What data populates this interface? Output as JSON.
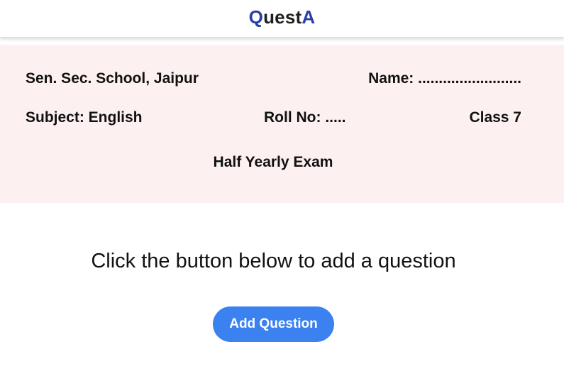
{
  "app": {
    "logo_part1_accent": "Q",
    "logo_part2": "uest",
    "logo_part3_accent": "A",
    "accent_color": "#2a3fa8"
  },
  "exam_header": {
    "school": "Sen. Sec. School, Jaipur",
    "name_label": "Name: .........................",
    "subject": "Subject: English",
    "roll_no": "Roll No: .....",
    "class": "Class 7",
    "exam_title": "Half Yearly Exam",
    "background_color": "#fdf0f0"
  },
  "main": {
    "prompt": "Click the button below to add a question",
    "add_button_label": "Add Question",
    "button_color": "#3b82f0"
  }
}
